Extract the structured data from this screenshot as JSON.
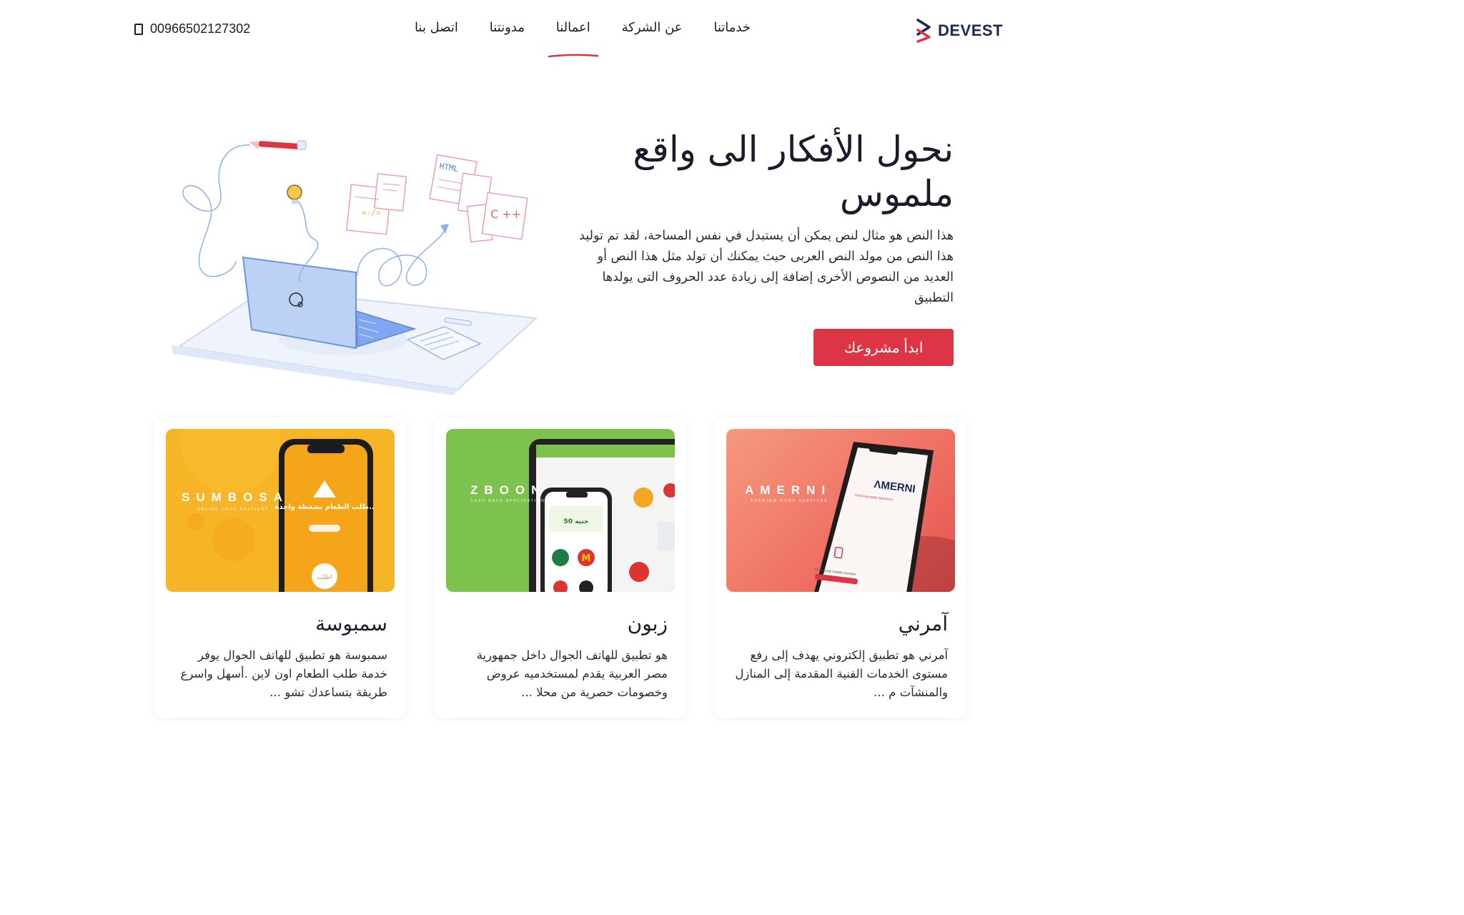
{
  "header": {
    "logo_text": "DEVEST",
    "nav": [
      {
        "label": "خدماتنا",
        "active": false
      },
      {
        "label": "عن الشركة",
        "active": false
      },
      {
        "label": "اعمالنا",
        "active": true
      },
      {
        "label": "مدونتنا",
        "active": false
      },
      {
        "label": "اتصل بنا",
        "active": false
      }
    ],
    "phone": "00966502127302"
  },
  "hero": {
    "title_line1": "نحول الأفكار الى واقع",
    "title_line2": "ملموس",
    "description": "هذا النص هو مثال لنص يمكن أن يستبدل في نفس المساحة، لقد تم توليد هذا النص من مولد النص العربى حيث يمكنك أن تولد مثل هذا النص أو العديد من النصوص الأخرى إضافة إلى زيادة عدد الحروف التى يولدها التطبيق",
    "cta_label": "ابدأ مشروعك",
    "illustration_labels": {
      "html": "HTML",
      "cpp": "C ++",
      "code": "<-/>"
    }
  },
  "cards": [
    {
      "title": "سمبوسة",
      "description": "سمبوسة هو تطبيق للهاتف الجوال يوفر خدمة طلب الطعام اون لاين .أسهل واسرع طريقة بتساعدك تشو ...",
      "brand": "SUMBOSA",
      "brand_sub": "ONLINE FOOD DELIVERY",
      "screen_text": "طلب الطعام بضغطة واحدة..",
      "screen_button": "اطلب",
      "color": "#f6b526"
    },
    {
      "title": "زبون",
      "description": "هو تطبيق للهاتف الجوال داخل جمهورية مصر العربية يقدم لمستخدميه عروض وخصومات حصرية من محلا ...",
      "brand": "ZBOON",
      "brand_sub": "CASH BACK APPLICATION",
      "screen_text": "50 جنيه",
      "color": "#7dc24d"
    },
    {
      "title": "آمرني",
      "description": "آمرني هو تطبيق إلكتروني يهدف إلى رفع مستوى الخدمات الفنية المقدمة إلى المنازل والمنشآت م ...",
      "brand": "AMERNI",
      "brand_sub": "PREMIUM HOME SERVICES",
      "screen_text": "ΛMERNI",
      "screen_sub": "PREMIUM HOME SERVICES",
      "screen_field": "Enter your mobile number",
      "color": "#f27f6b"
    }
  ],
  "colors": {
    "accent": "#dc3545",
    "brand_navy": "#1b2a55"
  }
}
